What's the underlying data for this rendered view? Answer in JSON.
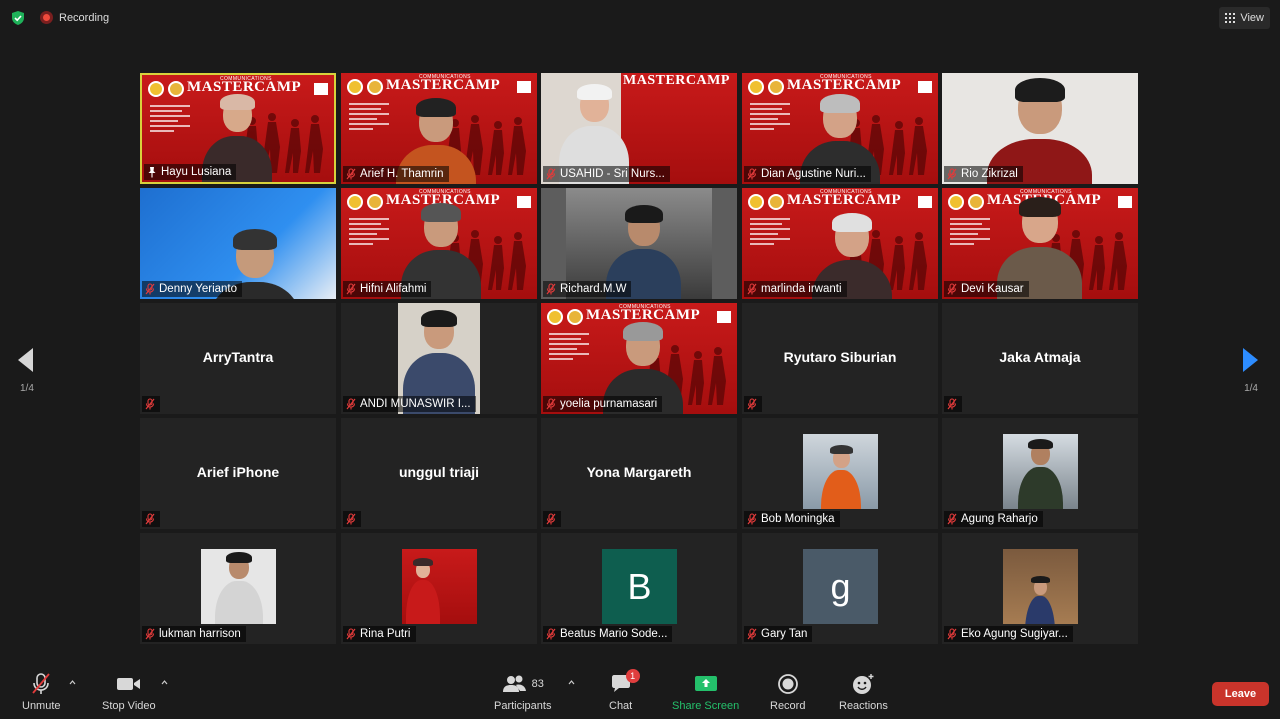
{
  "top": {
    "recording_label": "Recording",
    "view_label": "View"
  },
  "pagination": {
    "left": "1/4",
    "right": "1/4"
  },
  "participants": [
    {
      "name": "Hayu Lusiana",
      "kind": "video",
      "active": true,
      "pinned": true
    },
    {
      "name": "Arief H. Thamrin",
      "kind": "video"
    },
    {
      "name": "USAHID - Sri Nurs...",
      "kind": "video"
    },
    {
      "name": "Dian Agustine Nuri...",
      "kind": "video"
    },
    {
      "name": "Rio Zikrizal",
      "kind": "video"
    },
    {
      "name": "Denny Yerianto",
      "kind": "video"
    },
    {
      "name": "Hifni Alifahmi",
      "kind": "video"
    },
    {
      "name": "Richard.M.W",
      "kind": "video"
    },
    {
      "name": "marlinda irwanti",
      "kind": "video"
    },
    {
      "name": "Devi Kausar",
      "kind": "video"
    },
    {
      "name": "ArryTantra",
      "kind": "name"
    },
    {
      "name": "ANDI MUNASWIR I...",
      "kind": "photo"
    },
    {
      "name": "yoelia purnamasari",
      "kind": "video"
    },
    {
      "name": "Ryutaro Siburian",
      "kind": "name"
    },
    {
      "name": "Jaka Atmaja",
      "kind": "name"
    },
    {
      "name": "Arief iPhone",
      "kind": "name"
    },
    {
      "name": "unggul triaji",
      "kind": "name"
    },
    {
      "name": "Yona Margareth",
      "kind": "name"
    },
    {
      "name": "Bob Moningka",
      "kind": "photo"
    },
    {
      "name": "Agung Raharjo",
      "kind": "photo"
    },
    {
      "name": "lukman harrison",
      "kind": "photo"
    },
    {
      "name": "Rina Putri",
      "kind": "photo"
    },
    {
      "name": "Beatus Mario Sode...",
      "kind": "letter",
      "letter": "B",
      "color": "#0e5e4f"
    },
    {
      "name": "Gary Tan",
      "kind": "letter",
      "letter": "g",
      "color": "#4a5a68"
    },
    {
      "name": "Eko Agung Sugiyar...",
      "kind": "photo"
    }
  ],
  "banner": {
    "title": "MASTERCAMP",
    "subtitle": "COMMUNICATIONS"
  },
  "toolbar": {
    "unmute": "Unmute",
    "stop_video": "Stop Video",
    "participants": "Participants",
    "participants_count": "83",
    "chat": "Chat",
    "chat_badge": "1",
    "share_screen": "Share Screen",
    "record": "Record",
    "reactions": "Reactions",
    "leave": "Leave"
  },
  "colors": {
    "active_border": "#d8d23c",
    "share_green": "#24c06b",
    "leave_red": "#c9342b",
    "next_arrow": "#2d8cff"
  }
}
